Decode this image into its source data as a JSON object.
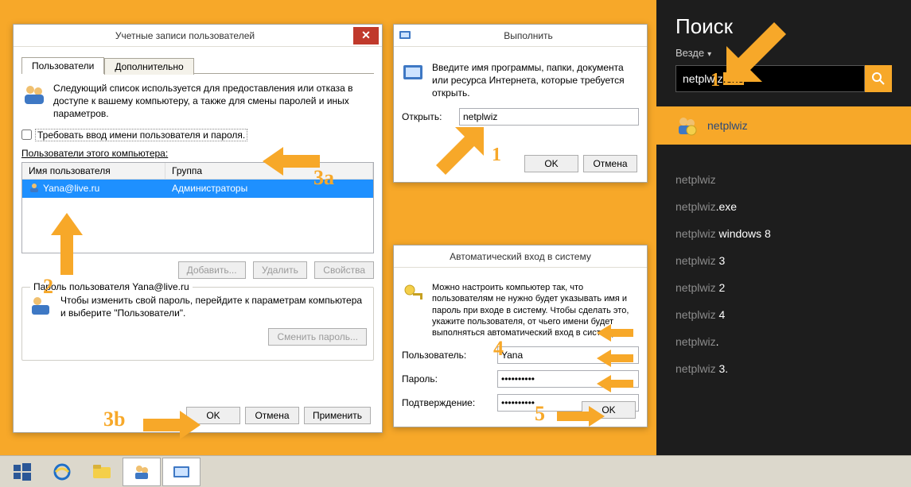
{
  "netplwiz": {
    "title": "Учетные записи пользователей",
    "tabs": {
      "users": "Пользователи",
      "advanced": "Дополнительно"
    },
    "info": "Следующий список используется для предоставления или отказа в доступе к вашему компьютеру, а также для смены паролей и иных параметров.",
    "require_label": "Требовать ввод имени пользователя и пароля.",
    "users_label": "Пользователи этого компьютера:",
    "col_name": "Имя пользователя",
    "col_group": "Группа",
    "user_name": "Yana@live.ru",
    "user_group": "Администраторы",
    "btn_add": "Добавить...",
    "btn_del": "Удалить",
    "btn_prop": "Свойства",
    "pw_legend": "Пароль пользователя Yana@live.ru",
    "pw_text": "Чтобы изменить свой пароль, перейдите к параметрам компьютера и выберите \"Пользователи\".",
    "btn_change_pw": "Сменить пароль...",
    "btn_ok": "OK",
    "btn_cancel": "Отмена",
    "btn_apply": "Применить"
  },
  "run": {
    "title": "Выполнить",
    "info": "Введите имя программы, папки, документа или ресурса Интернета, которые требуется открыть.",
    "open_label": "Открыть:",
    "open_value": "netplwiz",
    "btn_ok": "OK",
    "btn_cancel": "Отмена"
  },
  "autologin": {
    "title": "Автоматический вход в систему",
    "info": "Можно настроить компьютер так, что пользователям не нужно будет указывать имя и пароль при входе в систему. Чтобы сделать это, укажите пользователя, от чьего имени будет выполняться автоматический вход в систему:",
    "lbl_user": "Пользователь:",
    "val_user": "Yana",
    "lbl_pw": "Пароль:",
    "val_pw": "••••••••••",
    "lbl_conf": "Подтверждение:",
    "val_conf": "••••••••••",
    "btn_ok": "OK"
  },
  "search": {
    "title": "Поиск",
    "scope": "Везде",
    "query_prefix": "netplwiz",
    "query_sel": ".exe",
    "top_hit": "netplwiz",
    "suggestions": [
      {
        "base": "netplwiz",
        "hl": ""
      },
      {
        "base": "netplwiz",
        "hl": ".exe"
      },
      {
        "base": "netplwiz ",
        "hl": "windows 8"
      },
      {
        "base": "netplwiz ",
        "hl": "3"
      },
      {
        "base": "netplwiz ",
        "hl": "2"
      },
      {
        "base": "netplwiz ",
        "hl": "4"
      },
      {
        "base": "netplwiz",
        "hl": "."
      },
      {
        "base": "netplwiz ",
        "hl": "3."
      }
    ]
  },
  "annotations": {
    "n1_right": "1",
    "n1_left": "1",
    "n2": "2",
    "n3a": "3a",
    "n3b": "3b",
    "n4": "4",
    "n5": "5"
  }
}
